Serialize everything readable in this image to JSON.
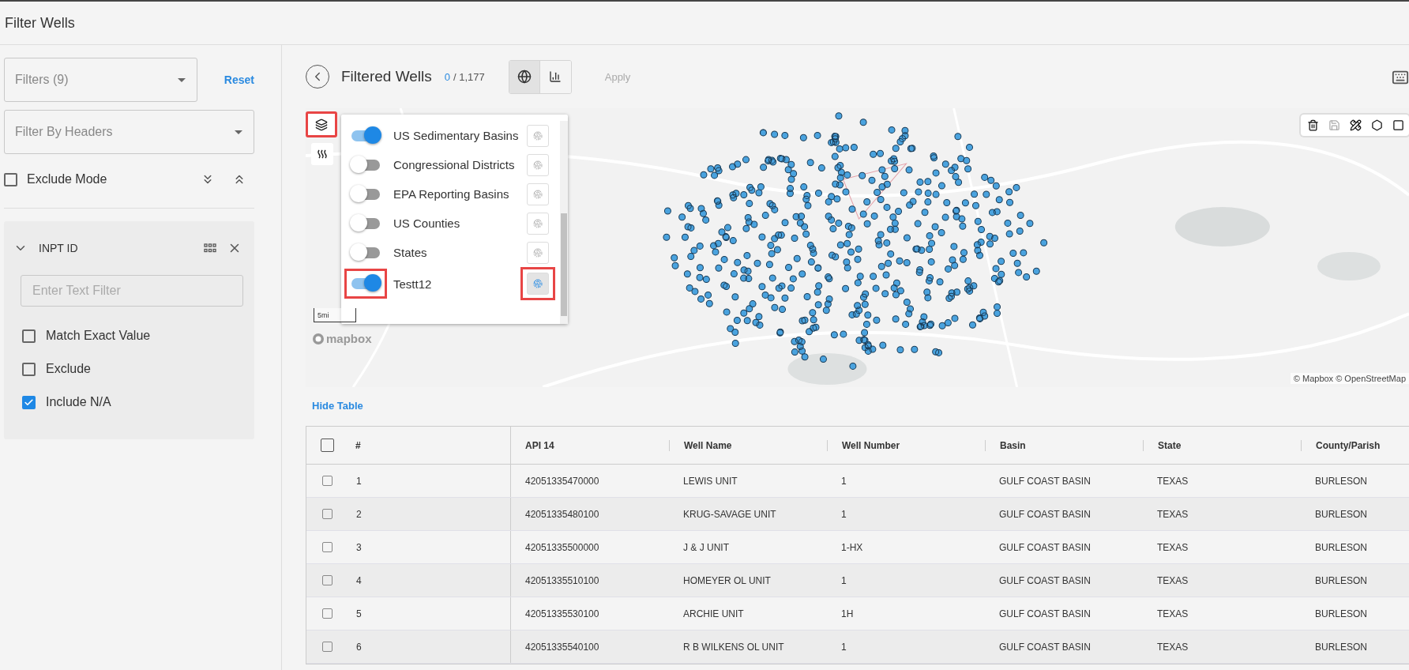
{
  "header": {
    "title": "Filter Wells"
  },
  "sidebar": {
    "filters_select": {
      "value": "Filters (9)"
    },
    "reset_link": "Reset",
    "headers_select": {
      "placeholder": "Filter By Headers"
    },
    "exclude_mode": {
      "label": "Exclude Mode",
      "checked": false
    },
    "filter_card": {
      "title": "INPT ID",
      "expanded": true,
      "text_filter": {
        "placeholder": "Enter Text Filter"
      },
      "options": [
        {
          "label": "Match Exact Value",
          "checked": false
        },
        {
          "label": "Exclude",
          "checked": false
        },
        {
          "label": "Include N/A",
          "checked": true
        }
      ]
    }
  },
  "toolbar": {
    "title": "Filtered Wells",
    "selected_count": "0",
    "total_count": "/ 1,177",
    "view_buttons": [
      {
        "kind": "map",
        "selected": true
      },
      {
        "kind": "chart",
        "selected": false
      }
    ],
    "apply_button": {
      "label": "Apply",
      "disabled": true
    }
  },
  "map": {
    "layers_button": {
      "highlighted": true
    },
    "layers": [
      {
        "label": "US Sedimentary Basins",
        "on": true,
        "highlighted": false,
        "active": false
      },
      {
        "label": "Congressional Districts",
        "on": false,
        "highlighted": false,
        "active": false
      },
      {
        "label": "EPA Reporting Basins",
        "on": false,
        "highlighted": false,
        "active": false
      },
      {
        "label": "US Counties",
        "on": false,
        "highlighted": false,
        "active": false
      },
      {
        "label": "States",
        "on": false,
        "highlighted": false,
        "active": false
      },
      {
        "label": "Testt12",
        "on": true,
        "highlighted": true,
        "active": true
      }
    ],
    "scale": "5mi",
    "logo": "mapbox",
    "attribution": "© Mapbox © OpenStreetMap",
    "draw_tools": [
      {
        "kind": "trash",
        "disabled": false
      },
      {
        "kind": "save",
        "disabled": true
      },
      {
        "kind": "edit",
        "disabled": false
      },
      {
        "kind": "polygon",
        "disabled": false
      },
      {
        "kind": "rectangle",
        "disabled": false
      }
    ]
  },
  "hide_table_link": "Hide Table",
  "table": {
    "all_selected": false,
    "columns": [
      "#",
      "API 14",
      "Well Name",
      "Well Number",
      "Basin",
      "State",
      "County/Parish"
    ],
    "rows": [
      {
        "selected": false,
        "cells": [
          "1",
          "42051335470000",
          "LEWIS UNIT",
          "1",
          "GULF COAST BASIN",
          "TEXAS",
          "BURLESON"
        ]
      },
      {
        "selected": false,
        "cells": [
          "2",
          "42051335480100",
          "KRUG-SAVAGE UNIT",
          "1",
          "GULF COAST BASIN",
          "TEXAS",
          "BURLESON"
        ]
      },
      {
        "selected": false,
        "cells": [
          "3",
          "42051335500000",
          "J & J UNIT",
          "1-HX",
          "GULF COAST BASIN",
          "TEXAS",
          "BURLESON"
        ]
      },
      {
        "selected": false,
        "cells": [
          "4",
          "42051335510100",
          "HOMEYER OL UNIT",
          "1",
          "GULF COAST BASIN",
          "TEXAS",
          "BURLESON"
        ]
      },
      {
        "selected": false,
        "cells": [
          "5",
          "42051335530100",
          "ARCHIE UNIT",
          "1H",
          "GULF COAST BASIN",
          "TEXAS",
          "BURLESON"
        ]
      },
      {
        "selected": false,
        "cells": [
          "6",
          "42051335540100",
          "R B WILKENS OL UNIT",
          "1",
          "GULF COAST BASIN",
          "TEXAS",
          "BURLESON"
        ]
      }
    ]
  }
}
